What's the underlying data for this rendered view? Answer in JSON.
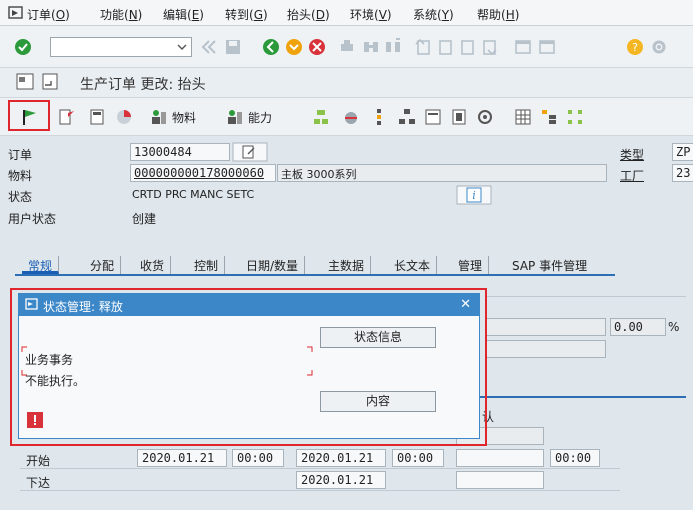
{
  "menu": [
    {
      "text": "订单(",
      "key": "O",
      "end": ")"
    },
    {
      "text": "功能(",
      "key": "N",
      "end": ")"
    },
    {
      "text": "编辑(",
      "key": "E",
      "end": ")"
    },
    {
      "text": "转到(",
      "key": "G",
      "end": ")"
    },
    {
      "text": "抬头(",
      "key": "D",
      "end": ")"
    },
    {
      "text": "环境(",
      "key": "V",
      "end": ")"
    },
    {
      "text": "系统(",
      "key": "Y",
      "end": ")"
    },
    {
      "text": "帮助(",
      "key": "H",
      "end": ")"
    }
  ],
  "title": "生产订单 更改: 抬头",
  "apptoolbar": {
    "material_label": "物料",
    "capacity_label": "能力"
  },
  "header": {
    "order_label": "订单",
    "order_value": "13000484",
    "material_label": "物料",
    "material_value": "000000000178000060",
    "material_desc": "主板 3000系列",
    "status_label": "状态",
    "status_value": "CRTD PRC  MANC SETC",
    "user_status_label": "用户状态",
    "user_status_value": "创建",
    "type_label": "类型",
    "type_value": "ZP",
    "plant_label": "工厂",
    "plant_value": "23"
  },
  "tabs": [
    "常规",
    "分配",
    "收货",
    "控制",
    "日期/数量",
    "主数据",
    "长文本",
    "管理",
    "SAP 事件管理"
  ],
  "background": {
    "percent_value": "0.00",
    "percent_unit": "%",
    "partial_label": "认"
  },
  "dialog": {
    "title": "状态管理: 释放",
    "status_info_button": "状态信息",
    "content_button": "内容",
    "message_line1": "业务事务",
    "message_line2": "不能执行。",
    "close": "✕"
  },
  "dates": {
    "start_label": "开始",
    "start_date": "2020.01.21",
    "start_time": "00:00",
    "start_date2": "2020.01.21",
    "start_time2": "00:00",
    "start_time3": "00:00",
    "release_label": "下达",
    "release_date": "2020.01.21"
  },
  "colors": {
    "accent": "#3c87c8",
    "highlight": "#e0262d",
    "flag_green": "#2c9a3a"
  }
}
